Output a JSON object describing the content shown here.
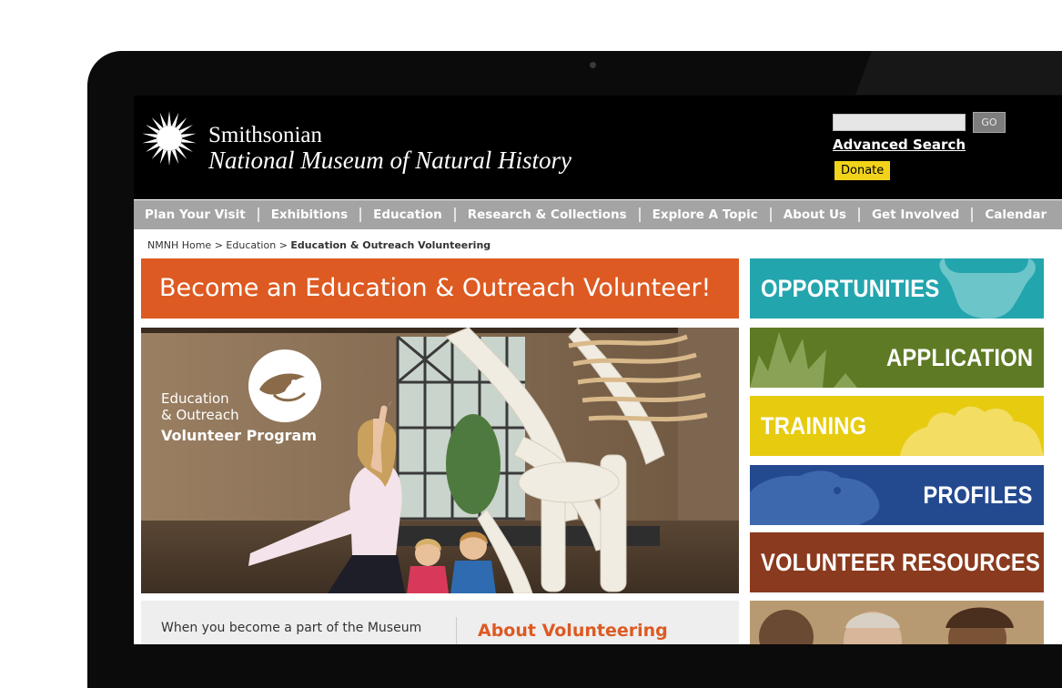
{
  "site": {
    "brand_line1": "Smithsonian",
    "brand_line2": "National Museum of Natural History"
  },
  "search": {
    "value": "",
    "go_label": "GO",
    "advanced_label": "Advanced Search",
    "donate_label": "Donate"
  },
  "nav": {
    "items": [
      {
        "label": "Plan Your Visit"
      },
      {
        "label": "Exhibitions"
      },
      {
        "label": "Education"
      },
      {
        "label": "Research & Collections"
      },
      {
        "label": "Explore A Topic"
      },
      {
        "label": "About Us"
      },
      {
        "label": "Get Involved"
      },
      {
        "label": "Calendar"
      }
    ]
  },
  "breadcrumb": {
    "home": "NMNH Home",
    "sep": ">",
    "education": "Education",
    "current": "Education & Outreach Volunteering"
  },
  "main": {
    "banner_title": "Become an Education & Outreach Volunteer!",
    "hero": {
      "program_line1": "Education",
      "program_line2": "& Outreach",
      "program_line3": "Volunteer Program"
    },
    "intro_text": "When you become a part of the Museum",
    "about_heading": "About Volunteering"
  },
  "sidebar": {
    "tiles": [
      {
        "label": "OPPORTUNITIES",
        "color": "#23a5ad"
      },
      {
        "label": "APPLICATION",
        "color": "#5e7a24"
      },
      {
        "label": "TRAINING",
        "color": "#e6cb0f"
      },
      {
        "label": "PROFILES",
        "color": "#23498f"
      },
      {
        "label": "VOLUNTEER RESOURCES",
        "color": "#8a3a1e"
      }
    ]
  },
  "colors": {
    "accent_orange": "#dd5a22",
    "nav_gray": "#a4a4a4",
    "donate_yellow": "#f2d31b",
    "header_black": "#000000"
  }
}
